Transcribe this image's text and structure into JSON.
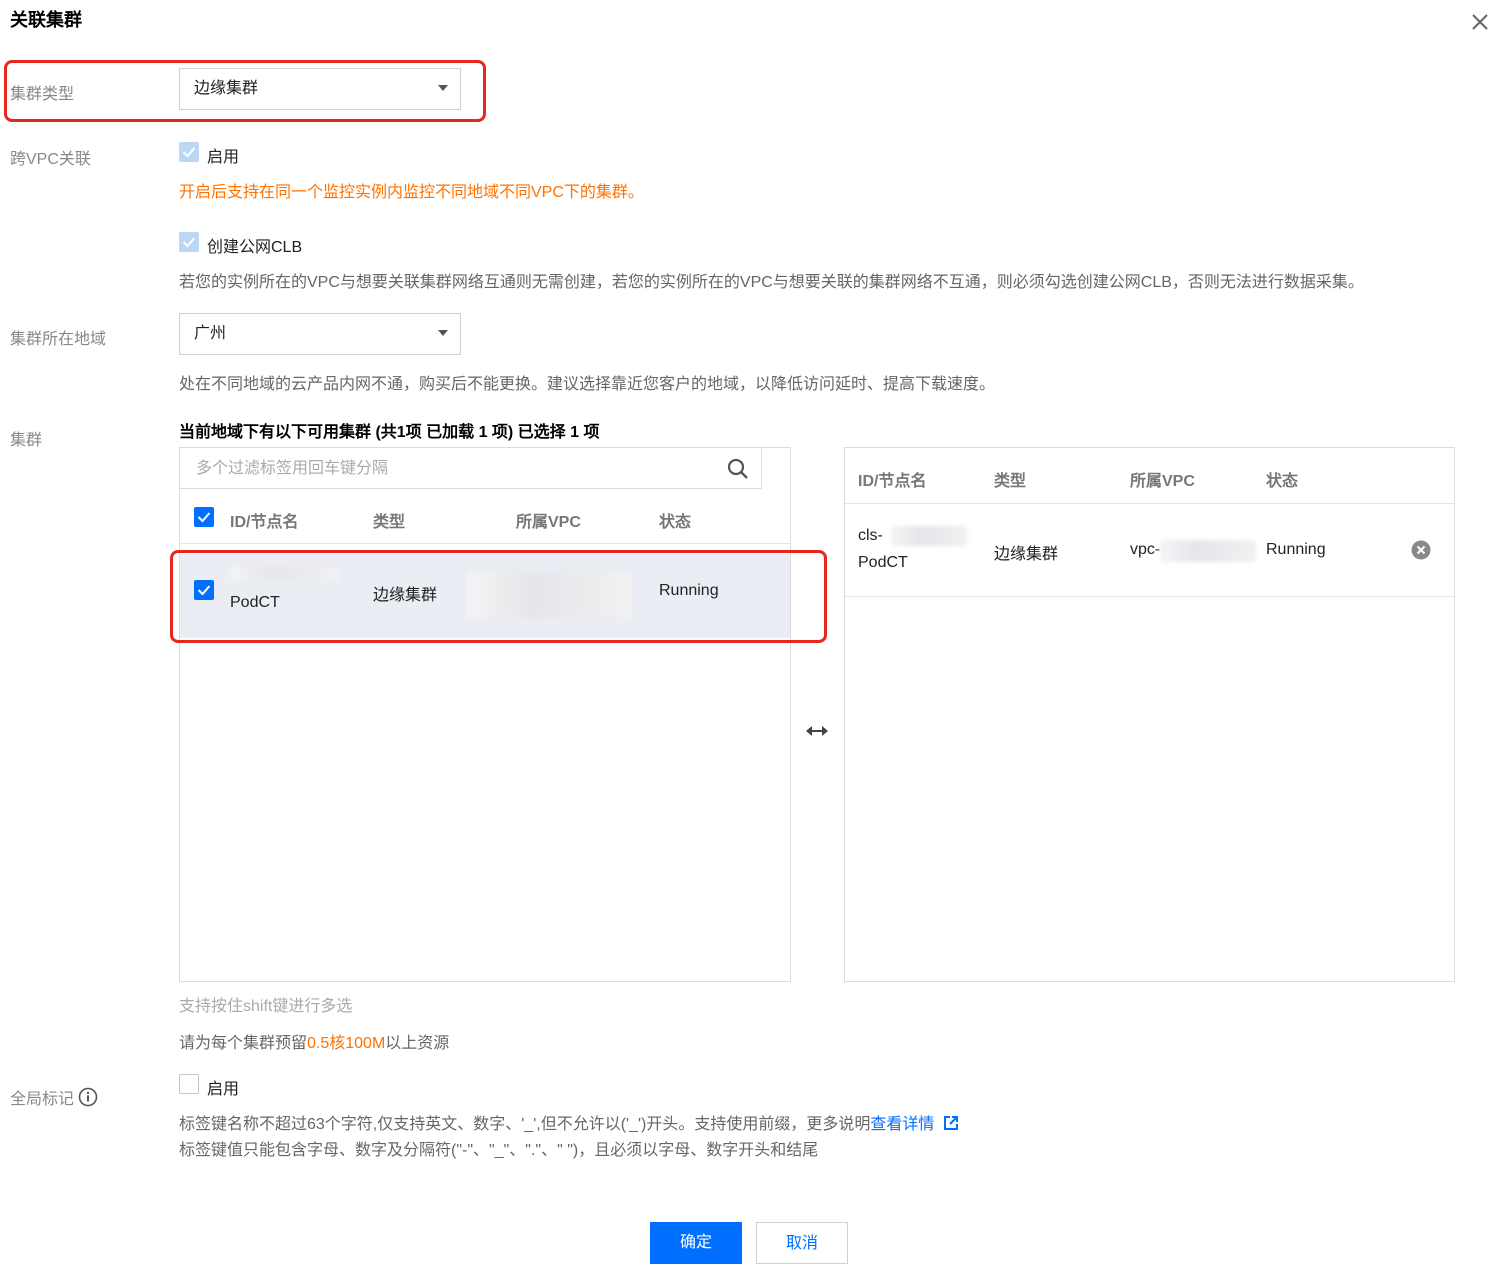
{
  "dialog": {
    "title": "关联集群"
  },
  "cluster_type": {
    "label": "集群类型",
    "value": "边缘集群"
  },
  "cross_vpc": {
    "label": "跨VPC关联",
    "checkbox_label": "启用",
    "checked": true,
    "note": "开启后支持在同一个监控实例内监控不同地域不同VPC下的集群。"
  },
  "public_clb": {
    "checkbox_label": "创建公网CLB",
    "checked": true,
    "note": "若您的实例所在的VPC与想要关联集群网络互通则无需创建，若您的实例所在的VPC与想要关联的集群网络不互通，则必须勾选创建公网CLB，否则无法进行数据采集。"
  },
  "region": {
    "label": "集群所在地域",
    "value": "广州",
    "note": "处在不同地域的云产品内网不通，购买后不能更换。建议选择靠近您客户的地域，以降低访问延时、提高下载速度。"
  },
  "cluster": {
    "label": "集群",
    "summary": "当前地域下有以下可用集群 (共1项 已加载 1 项) 已选择 1 项",
    "search_placeholder": "多个过滤标签用回车键分隔",
    "columns": [
      "ID/节点名",
      "类型",
      "所属VPC",
      "状态"
    ],
    "left_rows": [
      {
        "id": "",
        "name": "PodCT",
        "type": "边缘集群",
        "vpc": "",
        "status": "Running",
        "checked": true
      }
    ],
    "right_rows": [
      {
        "id": "cls-",
        "name": "PodCT",
        "type": "边缘集群",
        "vpc": "vpc-",
        "status": "Running"
      }
    ],
    "shift_hint": "支持按住shift键进行多选",
    "reserve_prefix": "请为每个集群预留",
    "reserve_value": "0.5核100M",
    "reserve_suffix": "以上资源"
  },
  "global_tag": {
    "label": "全局标记",
    "checkbox_label": "启用",
    "checked": false,
    "rule1": "标签键名称不超过63个字符,仅支持英文、数字、'_',但不允许以('_')开头。支持使用前缀，更多说明",
    "rule1_link": "查看详情",
    "rule2": "标签键值只能包含字母、数字及分隔符(\"-\"、\"_\"、\".\"、\" \")，且必须以字母、数字开头和结尾"
  },
  "footer": {
    "confirm_label": "确定",
    "cancel_label": "取消"
  },
  "colors": {
    "accent": "#006eff",
    "warning": "#ff7200",
    "highlight": "#e5281e"
  }
}
